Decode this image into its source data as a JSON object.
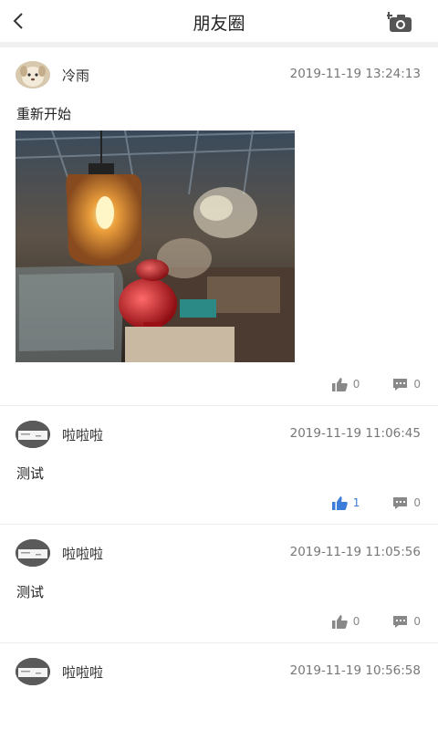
{
  "header": {
    "title": "朋友圈"
  },
  "posts": [
    {
      "user": "冷雨",
      "time": "2019-11-19 13:24:13",
      "text": "重新开始",
      "likes": "0",
      "comments": "0",
      "liked": false,
      "has_image": true
    },
    {
      "user": "啦啦啦",
      "time": "2019-11-19 11:06:45",
      "text": "测试",
      "likes": "1",
      "comments": "0",
      "liked": true
    },
    {
      "user": "啦啦啦",
      "time": "2019-11-19 11:05:56",
      "text": "测试",
      "likes": "0",
      "comments": "0",
      "liked": false
    },
    {
      "user": "啦啦啦",
      "time": "2019-11-19 10:56:58",
      "text": "",
      "likes": "",
      "comments": "",
      "liked": false
    }
  ],
  "colors": {
    "liked": "#3b7dd8",
    "muted": "#888888",
    "divider": "#ececec"
  },
  "icons": [
    "back-arrow-icon",
    "add-camera-icon",
    "thumbs-up-icon",
    "comment-icon"
  ]
}
